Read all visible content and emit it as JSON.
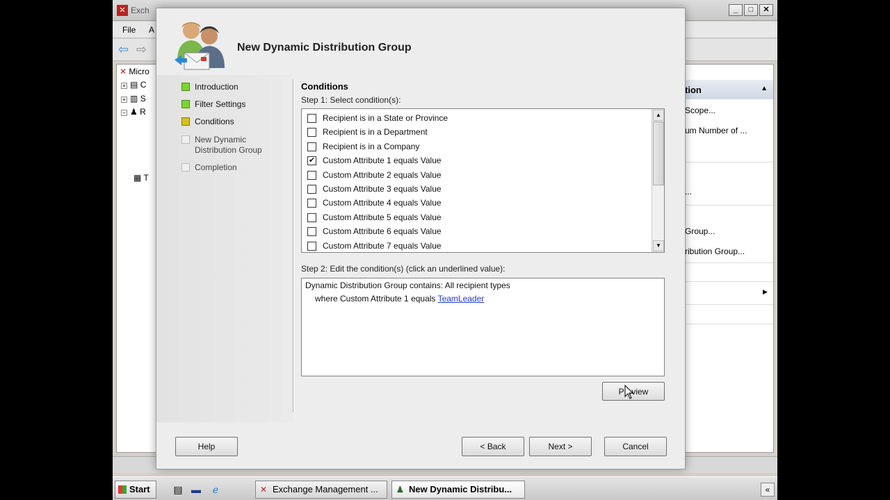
{
  "background_app": {
    "title": "Exch",
    "menu": [
      "File",
      "A"
    ],
    "tree": [
      "Micro",
      "C",
      "S",
      "R",
      "T"
    ],
    "actions_header": "tion",
    "actions": [
      "Scope...",
      "um Number of ...",
      "...",
      "Group...",
      "ribution Group..."
    ]
  },
  "wizard": {
    "title": "New Dynamic Distribution Group",
    "steps": [
      {
        "label": "Introduction",
        "state": "done"
      },
      {
        "label": "Filter Settings",
        "state": "done"
      },
      {
        "label": "Conditions",
        "state": "current"
      },
      {
        "label": "New Dynamic Distribution Group",
        "state": "todo"
      },
      {
        "label": "Completion",
        "state": "todo"
      }
    ],
    "section_title": "Conditions",
    "step1_label": "Step 1: Select condition(s):",
    "conditions": [
      {
        "label": "Recipient is in a State or Province",
        "checked": false
      },
      {
        "label": "Recipient is in a Department",
        "checked": false
      },
      {
        "label": "Recipient is in a Company",
        "checked": false
      },
      {
        "label": "Custom Attribute 1 equals Value",
        "checked": true
      },
      {
        "label": "Custom Attribute 2 equals Value",
        "checked": false
      },
      {
        "label": "Custom Attribute 3 equals Value",
        "checked": false
      },
      {
        "label": "Custom Attribute 4 equals Value",
        "checked": false
      },
      {
        "label": "Custom Attribute 5 equals Value",
        "checked": false
      },
      {
        "label": "Custom Attribute 6 equals Value",
        "checked": false
      },
      {
        "label": "Custom Attribute 7 equals Value",
        "checked": false
      }
    ],
    "step2_label": "Step 2: Edit the condition(s) (click an underlined value):",
    "edit_line1": "Dynamic Distribution Group contains: All recipient types",
    "edit_line2_prefix": "where Custom Attribute 1 equals",
    "edit_link": "TeamLeader",
    "buttons": {
      "preview": "Preview",
      "help": "Help",
      "back": "< Back",
      "next": "Next >",
      "cancel": "Cancel"
    }
  },
  "taskbar": {
    "start": "Start",
    "tasks": [
      {
        "label": "Exchange Management ...",
        "active": false
      },
      {
        "label": "New Dynamic Distribu...",
        "active": true
      }
    ],
    "tray_toggle": "«"
  },
  "colors": {
    "step_done": "#7cd62c",
    "step_current": "#d6c21a",
    "link": "#1a3cc8"
  }
}
